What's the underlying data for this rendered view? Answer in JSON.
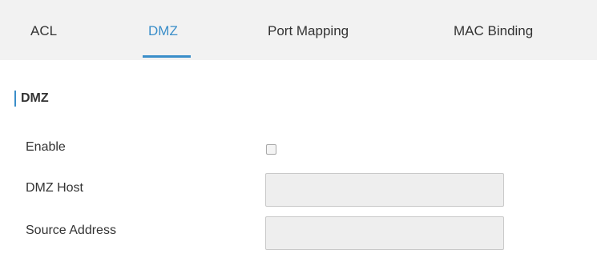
{
  "tabs": [
    {
      "label": "ACL",
      "active": false
    },
    {
      "label": "DMZ",
      "active": true
    },
    {
      "label": "Port Mapping",
      "active": false
    },
    {
      "label": "MAC Binding",
      "active": false
    }
  ],
  "section": {
    "title": "DMZ"
  },
  "form": {
    "enable": {
      "label": "Enable",
      "checked": false
    },
    "dmz_host": {
      "label": "DMZ Host",
      "value": ""
    },
    "source_address": {
      "label": "Source Address",
      "value": ""
    }
  },
  "colors": {
    "accent": "#3a8ec9",
    "tabbar_background": "#f2f2f2",
    "input_background": "#eeeeee",
    "text": "#333333"
  }
}
